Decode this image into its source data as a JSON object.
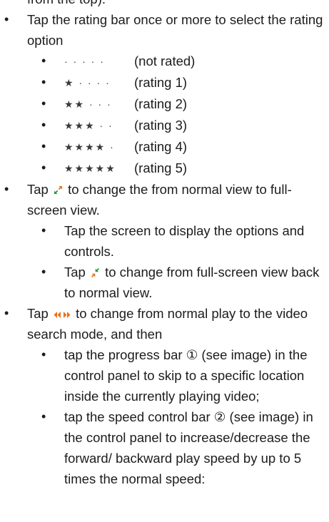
{
  "lines": {
    "l0": "from the top).",
    "b1": "Tap the rating bar once or more to select the rating option",
    "r0_stars": "· · · · ·",
    "r0_label": "(not rated)",
    "r1_stars": "★ · · · ·",
    "r1_label": "(rating 1)",
    "r2_stars": "★★ · · ·",
    "r2_label": "(rating 2)",
    "r3_stars": "★★★ · ·",
    "r3_label": "(rating 3)",
    "r4_stars": "★★★★ ·",
    "r4_label": "(rating 4)",
    "r5_stars": "★★★★★",
    "r5_label": "(rating 5)",
    "b2_pre": "Tap",
    "b2_post": "to change the from normal view to full-screen view.",
    "s21": "Tap the screen to display the options and controls.",
    "s22_pre": "Tap",
    "s22_post": "to change from full-screen view back to normal view.",
    "b3_pre": "Tap",
    "b3_post": "to change from normal play to the video search mode, and then",
    "s31": "tap the progress bar ① (see image) in the control panel to skip to a specific location inside the currently playing video;",
    "s32": "tap the speed control bar ② (see image) in the control panel to increase/decrease the forward/ backward play speed by up to 5 times the normal speed:",
    "bullet": "•"
  },
  "icons": {
    "expand": "expand-fullscreen-icon",
    "collapse": "collapse-fullscreen-icon",
    "search": "fast-rewind-forward-icon"
  },
  "colors": {
    "text": "#1c1c1c",
    "icon_orange": "#e8721c"
  }
}
